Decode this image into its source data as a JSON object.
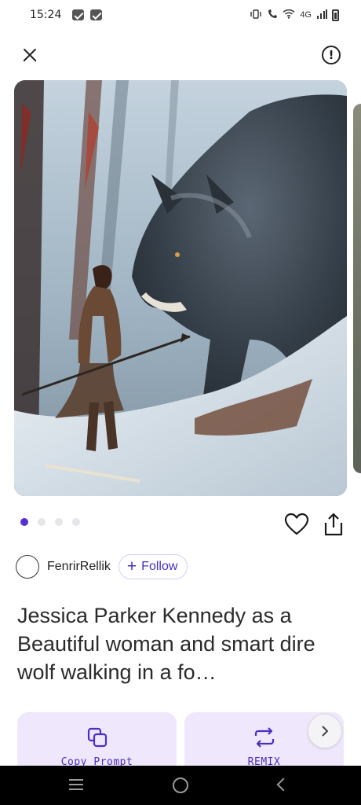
{
  "status_bar": {
    "time": "15:24",
    "network": "4G",
    "left_icons": [
      "notification-icon",
      "notification-icon"
    ],
    "right_icons": [
      "vibrate-icon",
      "wifi-call-icon",
      "wifi-icon",
      "signal-icon",
      "battery-icon"
    ]
  },
  "top_bar": {
    "close_icon": "close-icon",
    "report_icon": "info-icon"
  },
  "carousel": {
    "image_alt": "Woman warrior with spear walking beside a giant dire wolf in a snowy forest",
    "total_images": 4,
    "active_index": 0
  },
  "actions": {
    "like_icon": "heart-icon",
    "share_icon": "share-icon"
  },
  "author": {
    "name": "FenrirRellik",
    "follow_label": "Follow",
    "follow_icon": "plus-icon"
  },
  "prompt": {
    "title": "Jessica Parker Kennedy as a Beautiful woman and smart dire wolf walking in a fo…"
  },
  "buttons": {
    "copy_prompt": "Copy Prompt",
    "remix": "REMIX"
  },
  "colors": {
    "accent": "#4a2ec4",
    "dot_active": "#5a2fd0",
    "card_bg": "#efe7fb"
  }
}
